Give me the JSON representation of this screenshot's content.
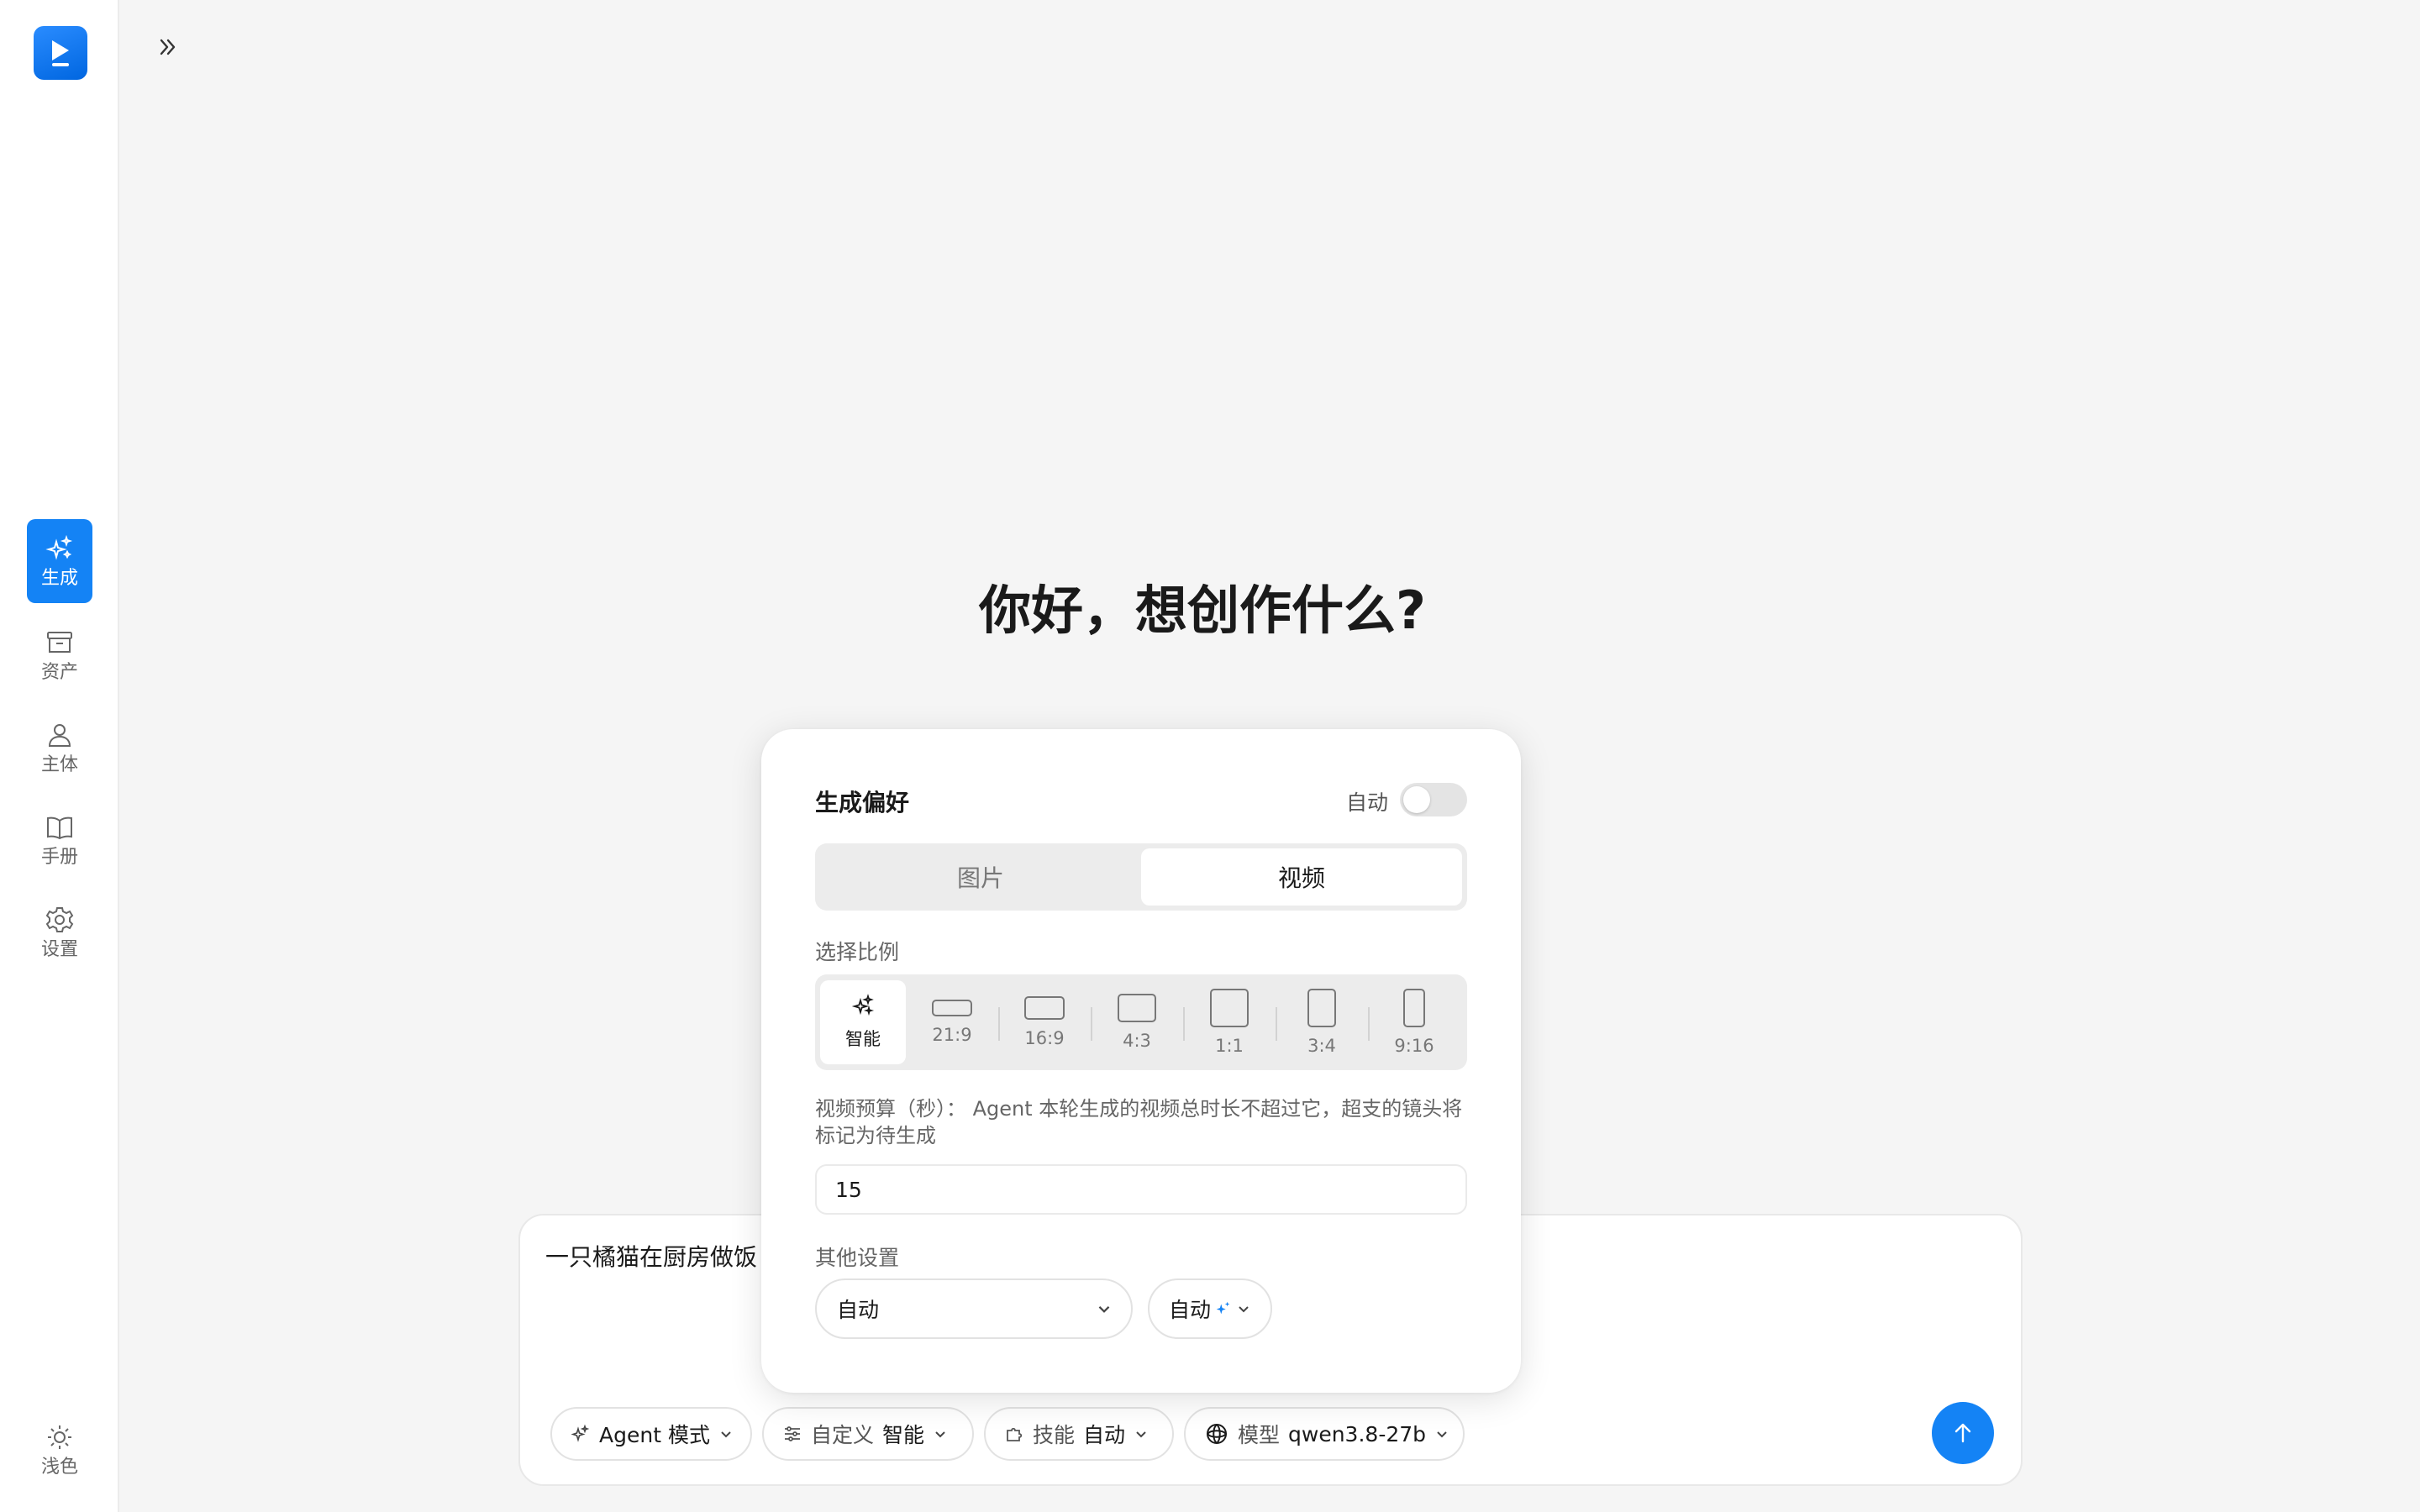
{
  "sidebar": {
    "logo": "play-logo-icon",
    "items": [
      {
        "label": "生成",
        "icon": "sparkle-icon",
        "active": true
      },
      {
        "label": "资产",
        "icon": "archive-icon"
      },
      {
        "label": "主体",
        "icon": "user-icon"
      },
      {
        "label": "手册",
        "icon": "book-icon"
      },
      {
        "label": "设置",
        "icon": "gear-icon"
      }
    ],
    "theme_label": "浅色"
  },
  "greeting": "你好，想创作什么?",
  "composer": {
    "prompt_text": "一只橘猫在厨房做饭",
    "chips": {
      "agent_label": "Agent 模式",
      "custom_label": "自定义",
      "custom_value": "智能",
      "skill_label": "技能",
      "skill_value": "自动",
      "model_label": "模型",
      "model_value": "qwen3.8-27b"
    }
  },
  "preferences": {
    "title": "生成偏好",
    "auto_label": "自动",
    "auto_enabled": false,
    "tabs": [
      "图片",
      "视频"
    ],
    "active_tab": "视频",
    "ratio_label": "选择比例",
    "ratios": [
      "智能",
      "21:9",
      "16:9",
      "4:3",
      "1:1",
      "3:4",
      "9:16"
    ],
    "selected_ratio": "智能",
    "budget_desc": "视频预算（秒）： Agent 本轮生成的视频总时长不超过它，超支的镜头将标记为待生成",
    "budget_value": "15",
    "other_label": "其他设置",
    "select_a_value": "自动",
    "select_b_value": "自动"
  },
  "colors": {
    "accent": "#1483f5",
    "background": "#f5f5f5"
  }
}
